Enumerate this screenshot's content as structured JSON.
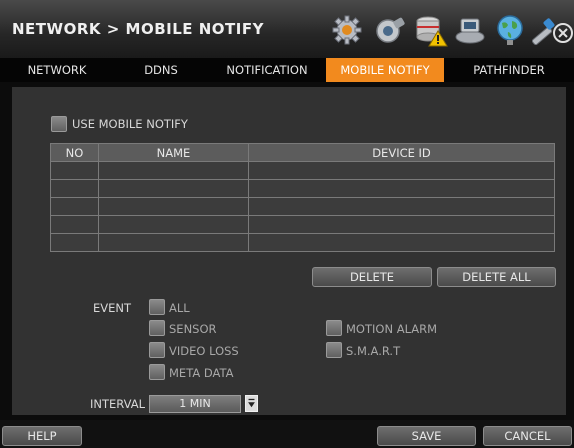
{
  "window": {
    "title": "NETWORK > MOBILE NOTIFY"
  },
  "toolbar": {
    "icons": [
      "gear-icon",
      "camera-icon",
      "storage-warning-icon",
      "devices-icon",
      "network-globe-icon",
      "tools-icon"
    ],
    "close_icon": "close-icon"
  },
  "tabs": [
    {
      "label": "NETWORK"
    },
    {
      "label": "DDNS"
    },
    {
      "label": "NOTIFICATION"
    },
    {
      "label": "MOBILE NOTIFY",
      "active": true
    },
    {
      "label": "PATHFINDER"
    }
  ],
  "use_mobile_notify": {
    "label": "USE MOBILE NOTIFY",
    "checked": false
  },
  "device_table": {
    "columns": [
      "NO",
      "NAME",
      "DEVICE ID"
    ],
    "rows": [
      [
        "",
        "",
        ""
      ],
      [
        "",
        "",
        ""
      ],
      [
        "",
        "",
        ""
      ],
      [
        "",
        "",
        ""
      ],
      [
        "",
        "",
        ""
      ]
    ]
  },
  "buttons": {
    "delete": "DELETE",
    "delete_all": "DELETE ALL"
  },
  "event": {
    "label": "EVENT",
    "all": "ALL",
    "sensor": "SENSOR",
    "video_loss": "VIDEO LOSS",
    "meta_data": "META DATA",
    "motion_alarm": "MOTION ALARM",
    "smart": "S.M.A.R.T"
  },
  "interval": {
    "label": "INTERVAL",
    "value": "1 MIN"
  },
  "footer": {
    "help": "HELP",
    "save": "SAVE",
    "cancel": "CANCEL"
  },
  "colors": {
    "accent": "#f28a1e",
    "panel": "#323232",
    "background": "#0c0c0c"
  }
}
